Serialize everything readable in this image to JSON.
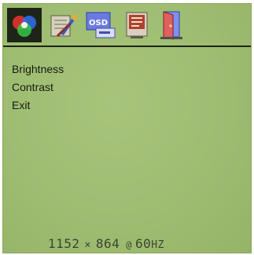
{
  "toolbar": {
    "tabs": [
      {
        "icon": "color-circles-icon",
        "selected": true
      },
      {
        "icon": "tools-icon",
        "selected": false
      },
      {
        "icon": "osd-icon",
        "selected": false
      },
      {
        "icon": "information-icon",
        "selected": false
      },
      {
        "icon": "exit-door-icon",
        "selected": false
      }
    ]
  },
  "menu": {
    "items": [
      "Brightness",
      "Contrast",
      "Exit"
    ]
  },
  "status": {
    "width": "1152",
    "times": "×",
    "height": "864",
    "at": "@",
    "refresh": "60",
    "unit": "HZ"
  },
  "colors": {
    "background": "#9fbd72",
    "text": "#141a10",
    "status_text": "#3a4430",
    "selected_tab": "#1e2418"
  }
}
